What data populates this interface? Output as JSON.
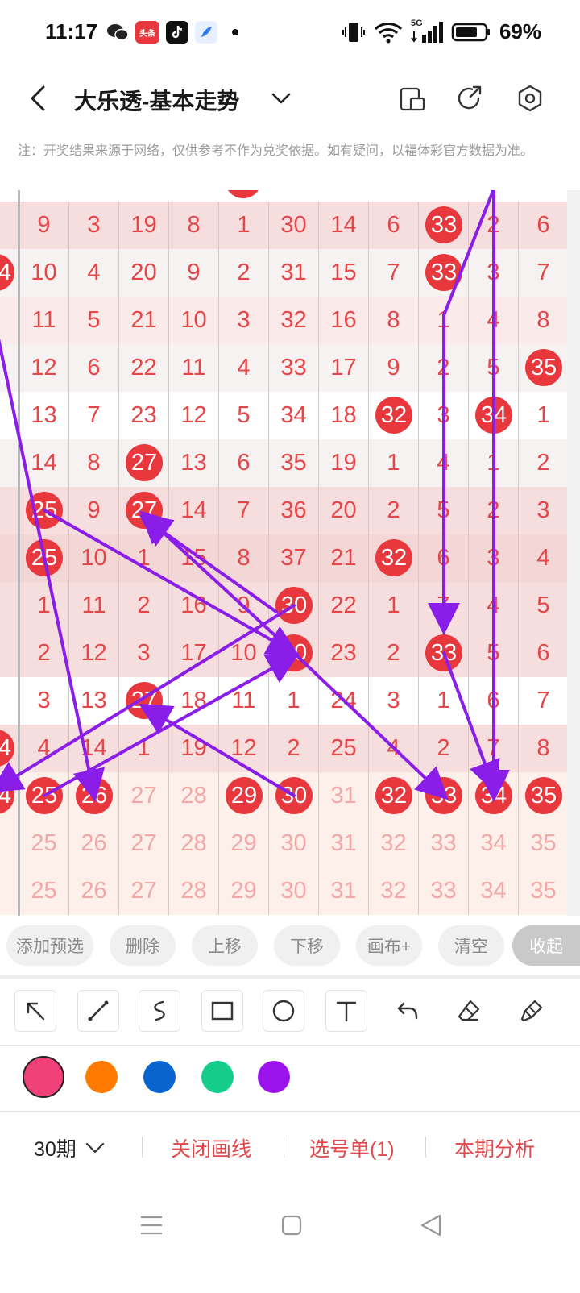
{
  "status": {
    "time": "11:17",
    "toutiao_label": "头条",
    "network": "5G",
    "battery": "69%"
  },
  "header": {
    "title": "大乐透-基本走势"
  },
  "note": "注：开奖结果来源于网络，仅供参考不作为兑奖依据。如有疑问，以福体彩官方数据为准。",
  "chart": {
    "rows": [
      {
        "cells": [
          "9",
          "3",
          "19",
          "8",
          "1",
          "30",
          "14",
          "6",
          "33",
          "2",
          "6"
        ],
        "balls": [
          8
        ],
        "bg": "#f7dede"
      },
      {
        "cells": [
          "10",
          "4",
          "20",
          "9",
          "2",
          "31",
          "15",
          "7",
          "33",
          "3",
          "7"
        ],
        "balls": [
          8
        ],
        "bg": "#f6f2f2"
      },
      {
        "cells": [
          "11",
          "5",
          "21",
          "10",
          "3",
          "32",
          "16",
          "8",
          "1",
          "4",
          "8"
        ],
        "balls": [],
        "bg": "#fbeaea"
      },
      {
        "cells": [
          "12",
          "6",
          "22",
          "11",
          "4",
          "33",
          "17",
          "9",
          "2",
          "5",
          "35"
        ],
        "balls": [
          10
        ],
        "bg": "#f6f2f2"
      },
      {
        "cells": [
          "13",
          "7",
          "23",
          "12",
          "5",
          "34",
          "18",
          "32",
          "3",
          "34",
          "1"
        ],
        "balls": [
          7,
          9
        ],
        "bg": "#ffffff"
      },
      {
        "cells": [
          "14",
          "8",
          "27",
          "13",
          "6",
          "35",
          "19",
          "1",
          "4",
          "1",
          "2"
        ],
        "balls": [
          2
        ],
        "bg": "#f6f2f2"
      },
      {
        "cells": [
          "25",
          "9",
          "27",
          "14",
          "7",
          "36",
          "20",
          "2",
          "5",
          "2",
          "3"
        ],
        "balls": [
          0,
          2
        ],
        "bg": "#f7dede"
      },
      {
        "cells": [
          "25",
          "10",
          "1",
          "15",
          "8",
          "37",
          "21",
          "32",
          "6",
          "3",
          "4"
        ],
        "balls": [
          0,
          7
        ],
        "bg": "#f3d6d6"
      },
      {
        "cells": [
          "1",
          "11",
          "2",
          "16",
          "9",
          "30",
          "22",
          "1",
          "7",
          "4",
          "5"
        ],
        "balls": [
          5
        ],
        "bg": "#f7dede"
      },
      {
        "cells": [
          "2",
          "12",
          "3",
          "17",
          "10",
          "30",
          "23",
          "2",
          "33",
          "5",
          "6"
        ],
        "balls": [
          5,
          8
        ],
        "bg": "#f7dede"
      },
      {
        "cells": [
          "3",
          "13",
          "27",
          "18",
          "11",
          "1",
          "24",
          "3",
          "1",
          "6",
          "7"
        ],
        "balls": [
          2
        ],
        "bg": "#ffffff"
      },
      {
        "cells": [
          "4",
          "14",
          "1",
          "19",
          "12",
          "2",
          "25",
          "4",
          "2",
          "7",
          "8"
        ],
        "balls": [],
        "bg": "#f7dede"
      },
      {
        "cells": [
          "25",
          "26",
          "27",
          "28",
          "29",
          "30",
          "31",
          "32",
          "33",
          "34",
          "35"
        ],
        "balls": [
          0,
          1,
          4,
          5,
          7,
          8,
          9,
          10
        ],
        "bg": "#fdf0ea"
      },
      {
        "cells": [
          "25",
          "26",
          "27",
          "28",
          "29",
          "30",
          "31",
          "32",
          "33",
          "34",
          "35"
        ],
        "balls": [],
        "bg": "#fdf0ea",
        "faded": true
      },
      {
        "cells": [
          "25",
          "26",
          "27",
          "28",
          "29",
          "30",
          "31",
          "32",
          "33",
          "34",
          "35"
        ],
        "balls": [],
        "bg": "#fdf0ea",
        "faded": true
      }
    ],
    "left_stub": [
      "4",
      "4",
      "4"
    ]
  },
  "actions": {
    "add": "添加预选",
    "delete": "删除",
    "up": "上移",
    "down": "下移",
    "canvas": "画布+",
    "clear": "清空",
    "collapse": "收起"
  },
  "tools": [
    "arrow-tool",
    "line-tool",
    "curve-tool",
    "rect-tool",
    "circle-tool",
    "text-tool",
    "undo-tool",
    "eraser-tool",
    "brush-tool"
  ],
  "colors": [
    "#f0407a",
    "#ff7a00",
    "#0a64d0",
    "#16cc8a",
    "#9b12ec"
  ],
  "bottom": {
    "period": "30期",
    "close_lines": "关闭画线",
    "pick_list": "选号单(1)",
    "analysis": "本期分析"
  },
  "accent": "#e2474a",
  "line_color": "#8a1ee8"
}
